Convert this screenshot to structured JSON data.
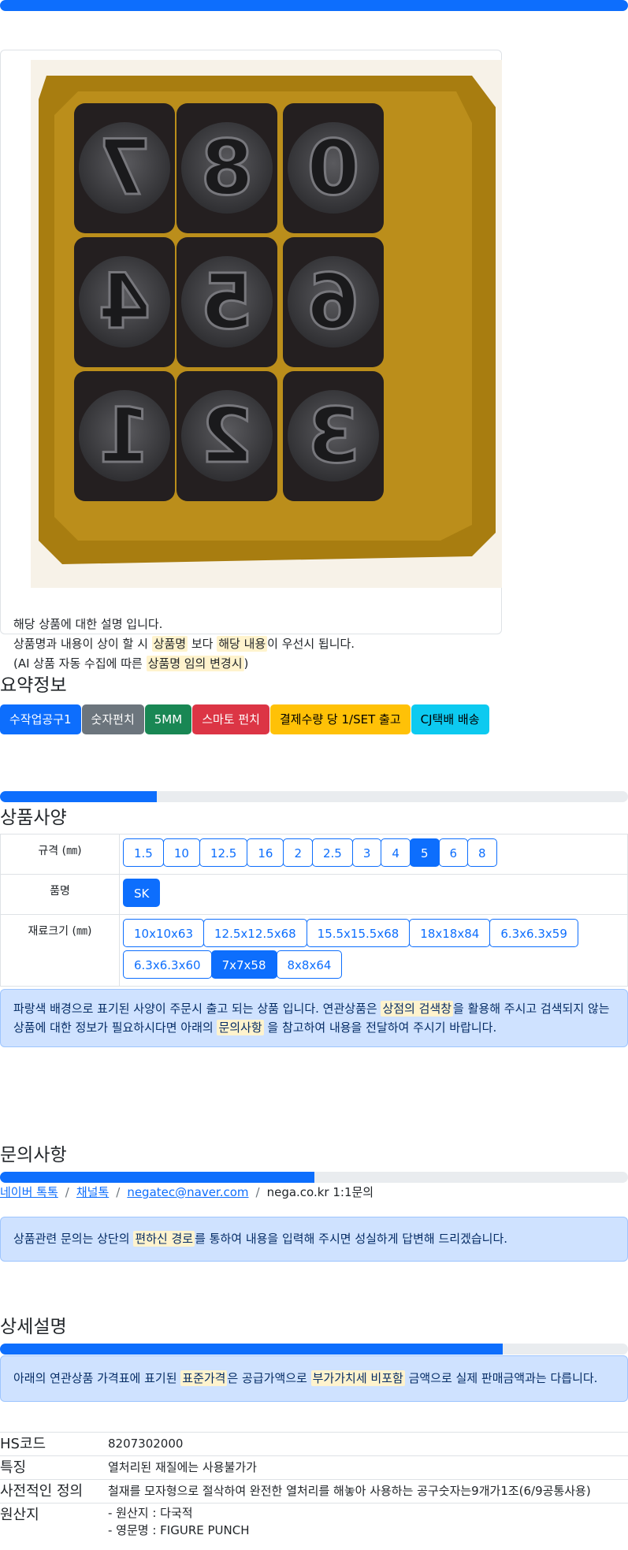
{
  "top_progress": {
    "percent": 100
  },
  "product_card": {
    "image_alt": "number punch set",
    "image_digits": [
      "7",
      "8",
      "0",
      "4",
      "5",
      "6",
      "1",
      "2",
      "3"
    ],
    "desc_line1": "해당 상품에 대한 설명 입니다.",
    "desc_line2_a": "상품명과 내용이 상이 할 시 ",
    "desc_line2_hl1": "상품명",
    "desc_line2_b": " 보다 ",
    "desc_line2_hl2": "해당 내용",
    "desc_line2_c": "이 우선시 됩니다.",
    "desc_line3_a": "(AI 상품 자동 수집에 따른 ",
    "desc_line3_hl": "상품명 임의 변경시",
    "desc_line3_b": ")"
  },
  "summary": {
    "title": "요약정보",
    "badges": [
      {
        "label": "수작업공구1",
        "color": "#0d6efd"
      },
      {
        "label": "숫자펀치",
        "color": "#6c757d"
      },
      {
        "label": "5MM",
        "color": "#198754"
      },
      {
        "label": "스마토 펀치",
        "color": "#dc3545"
      },
      {
        "label": "결제수량 당 1/SET 출고",
        "color": "#ffc107",
        "text_color": "#000000"
      },
      {
        "label": "CJ택배 배송",
        "color": "#0dcaf0",
        "text_color": "#000000"
      }
    ]
  },
  "spec": {
    "progress_percent": 25,
    "title": "상품사양",
    "rows": [
      {
        "label": "규격 (㎜)",
        "options": [
          "1.5",
          "10",
          "12.5",
          "16",
          "2",
          "2.5",
          "3",
          "4",
          "5",
          "6",
          "8"
        ],
        "selected": "5"
      },
      {
        "label": "품명",
        "options": [
          "SK"
        ],
        "selected": "SK"
      },
      {
        "label": "재료크기 (㎜)",
        "options": [
          "10x10x63",
          "12.5x12.5x68",
          "15.5x15.5x68",
          "18x18x84",
          "6.3x6.3x59",
          "6.3x6.3x60",
          "7x7x58",
          "8x8x64"
        ],
        "selected": "7x7x58"
      }
    ],
    "notice_a": "파랑색 배경으로 표기된 사양이 주문시 출고 되는 상품 입니다. 연관상품은 ",
    "notice_hl1": "상점의 검색창",
    "notice_b": "을 활용해 주시고 검색되지 않는 상품에 대한 정보가 필요하시다면 아래의 ",
    "notice_hl2": "문의사항",
    "notice_c": " 을 참고하여 내용을 전달하여 주시기 바랍니다."
  },
  "inquiry": {
    "title": "문의사항",
    "progress_percent": 50,
    "links": [
      "네이버 톡톡",
      "채널톡",
      "negatec@naver.com"
    ],
    "plain": "nega.co.kr 1:1문의",
    "notice_a": "상품관련 문의는 상단의 ",
    "notice_hl": "편하신 경로",
    "notice_b": "를 통하여 내용을 입력해 주시면 성실하게 답변해 드리겠습니다."
  },
  "detail": {
    "title": "상세설명",
    "progress_percent": 80,
    "notice_a": "아래의 연관상품 가격표에 표기된 ",
    "notice_hl1": "표준가격",
    "notice_b": "은 공급가액으로 ",
    "notice_hl2": "부가가치세 비포함",
    "notice_c": " 금액으로 실제 판매금액과는 다릅니다.",
    "rows": [
      {
        "key": "HS코드",
        "value": "8207302000"
      },
      {
        "key": "특징",
        "value": "열처리된 재질에는 사용불가가"
      },
      {
        "key": "사전적인 정의",
        "value": "철재를 모자형으로 절삭하여 완전한 열처리를 해놓아 사용하는 공구숫자는9개가1조(6/9공통사용)"
      }
    ],
    "origin": {
      "key": "원산지",
      "line1": "- 원산지 : 다국적",
      "line2": "- 영문명 : FIGURE PUNCH"
    }
  }
}
